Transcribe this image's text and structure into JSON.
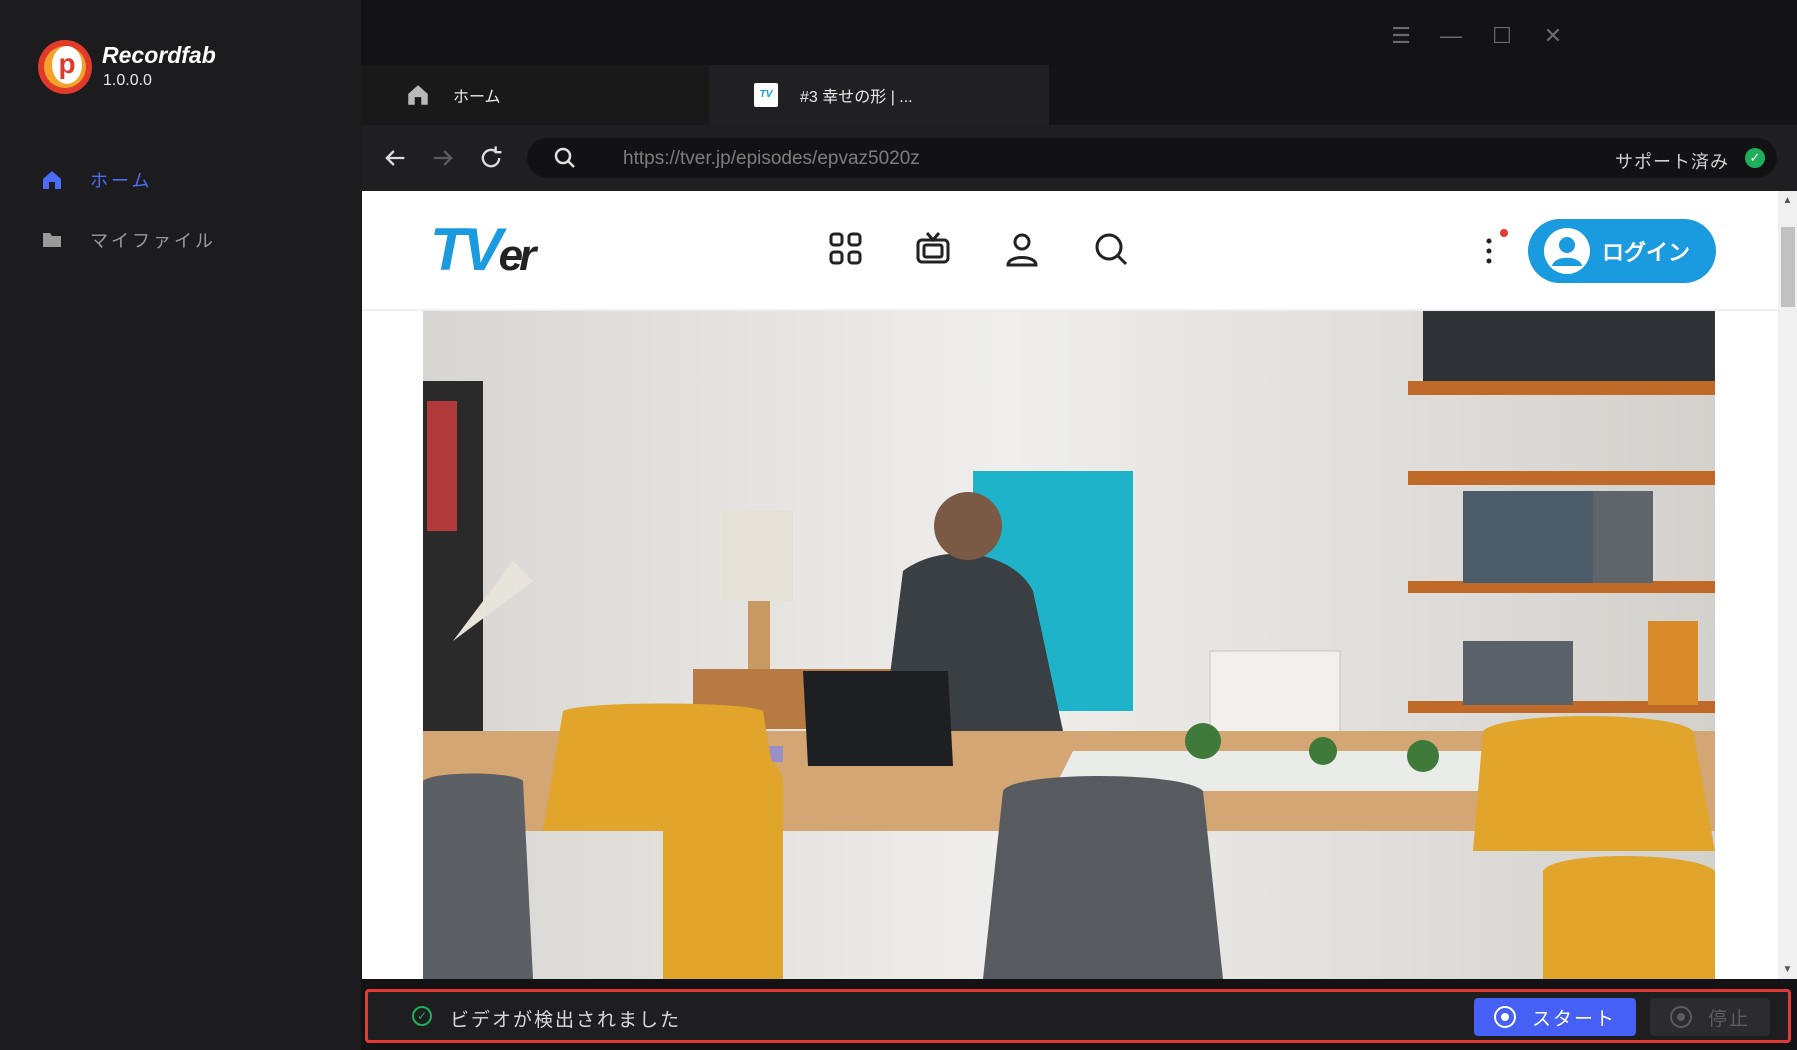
{
  "app": {
    "name": "Recordfab",
    "version": "1.0.0.0"
  },
  "sidebar": {
    "items": [
      {
        "label": "ホーム",
        "active": true
      },
      {
        "label": "マイファイル",
        "active": false
      }
    ]
  },
  "tabs": [
    {
      "label": "ホーム"
    },
    {
      "label": "#3 幸せの形 | ..."
    }
  ],
  "address": {
    "url": "https://tver.jp/episodes/epvaz5020z",
    "status": "サポート済み"
  },
  "webpage": {
    "logo_main": "TV",
    "logo_sub": "er",
    "login_label": "ログイン"
  },
  "statusbar": {
    "message": "ビデオが検出されました",
    "start_label": "スタート",
    "stop_label": "停止"
  },
  "colors": {
    "accent": "#4660f5",
    "success": "#1fae5c",
    "tver_blue": "#1a9be0",
    "highlight": "#e53935"
  }
}
